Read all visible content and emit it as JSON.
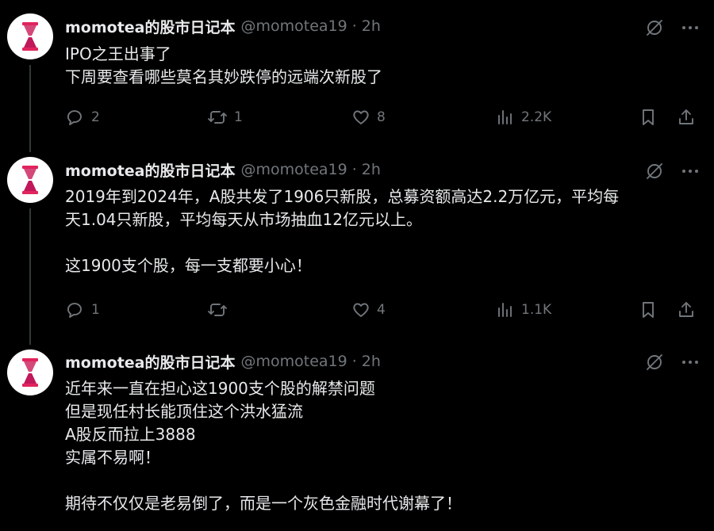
{
  "tweets": [
    {
      "author_name": "momotea的股市日记本",
      "handle": "@momotea19",
      "sep": "·",
      "time": "2h",
      "lines": [
        "IPO之王出事了",
        "下周要查看哪些莫名其妙跌停的远端次新股了"
      ],
      "replies": "2",
      "reposts": "1",
      "likes": "8",
      "views": "2.2K"
    },
    {
      "author_name": "momotea的股市日记本",
      "handle": "@momotea19",
      "sep": "·",
      "time": "2h",
      "lines": [
        "2019年到2024年，A股共发了1906只新股，总募资额高达2.2万亿元，平均每",
        "天1.04只新股，平均每天从市场抽血12亿元以上。",
        "",
        "这1900支个股，每一支都要小心！"
      ],
      "replies": "1",
      "reposts": "",
      "likes": "4",
      "views": "1.1K"
    },
    {
      "author_name": "momotea的股市日记本",
      "handle": "@momotea19",
      "sep": "·",
      "time": "2h",
      "lines": [
        "近年来一直在担心这1900支个股的解禁问题",
        "但是现任村长能顶住这个洪水猛流",
        "A股反而拉上3888",
        "实属不易啊！",
        "",
        "期待不仅仅是老易倒了，而是一个灰色金融时代谢幕了！"
      ]
    }
  ],
  "icons": {
    "grok": "grok-icon",
    "more": "more-icon",
    "reply": "reply-icon",
    "repost": "repost-icon",
    "like": "like-icon",
    "views": "views-icon",
    "bookmark": "bookmark-icon",
    "share": "share-icon"
  },
  "colors": {
    "background": "#000000",
    "text": "#e7e9ea",
    "muted": "#71767b",
    "avatar_accent": "#e0245e"
  }
}
